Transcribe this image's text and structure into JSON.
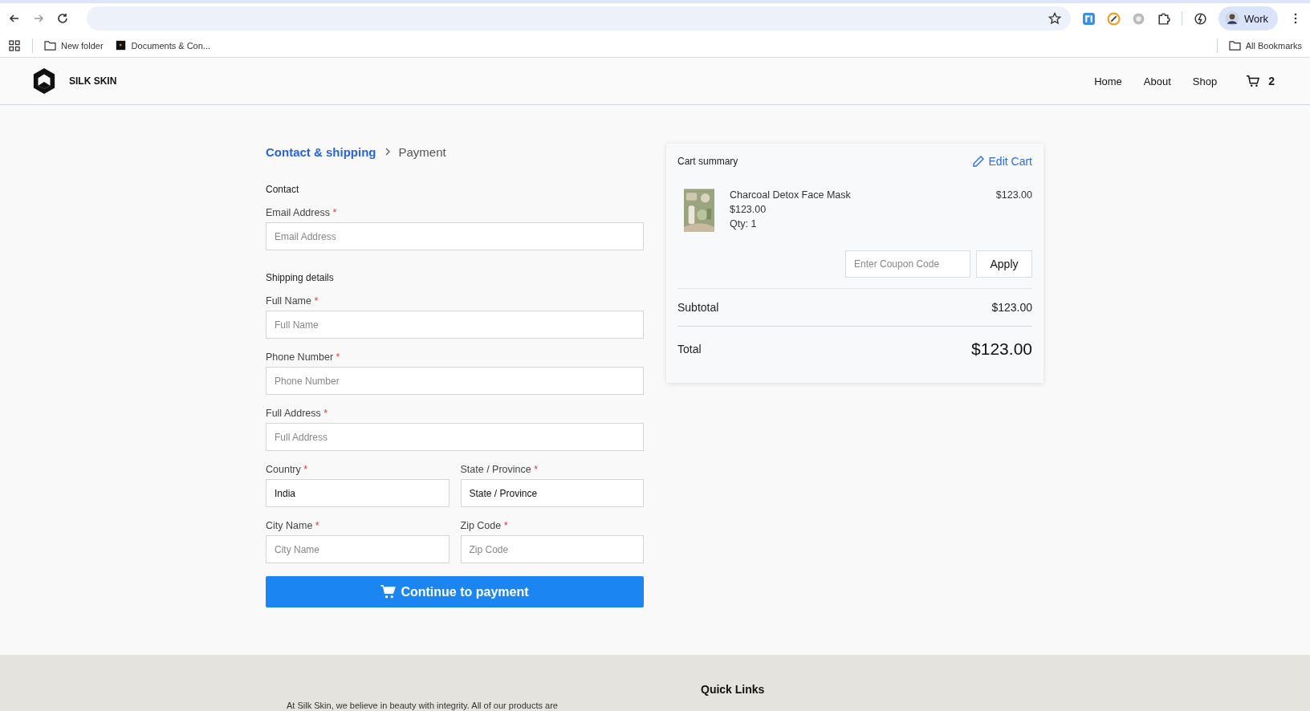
{
  "browser": {
    "bookmarks": [
      {
        "kind": "folder",
        "label": "New folder"
      },
      {
        "kind": "page",
        "label": "Documents & Con..."
      }
    ],
    "all_bookmarks": "All Bookmarks",
    "profile": "Work"
  },
  "header": {
    "brand": "SILK SKIN",
    "nav": [
      "Home",
      "About",
      "Shop"
    ],
    "cart_count": "2"
  },
  "breadcrumb": [
    {
      "label": "Contact & shipping",
      "selected": true
    },
    {
      "label": "Payment",
      "selected": false
    }
  ],
  "sections": [
    {
      "title": "Contact",
      "rows": [
        [
          {
            "label": "Email Address",
            "required_mark": "*",
            "placeholder": "Email Address"
          }
        ]
      ]
    },
    {
      "title": "Shipping details",
      "rows": [
        [
          {
            "label": "Full Name",
            "required_mark": "*",
            "placeholder": "Full Name"
          }
        ],
        [
          {
            "label": "Phone Number",
            "required_mark": "*",
            "placeholder": "Phone Number"
          }
        ],
        [
          {
            "label": "Full Address",
            "required_mark": "*",
            "placeholder": "Full Address"
          }
        ],
        [
          {
            "label": "Country",
            "required_mark": "*",
            "value": "India"
          },
          {
            "label": "State / Province",
            "required_mark": "*",
            "value": "State / Province"
          }
        ],
        [
          {
            "label": "City Name",
            "required_mark": "*",
            "placeholder": "City Name"
          },
          {
            "label": "Zip Code",
            "required_mark": "*",
            "placeholder": "Zip Code"
          }
        ]
      ]
    }
  ],
  "submit": "Continue to payment",
  "cart": {
    "title": "Cart summary",
    "edit": "Edit Cart",
    "items": [
      {
        "name": "Charcoal Detox Face Mask",
        "price": "$123.00",
        "qty": "Qty: 1",
        "line_total": "$123.00"
      }
    ],
    "coupon_placeholder": "Enter Coupon Code",
    "apply": "Apply",
    "subtotal_label": "Subtotal",
    "subtotal": "$123.00",
    "total_label": "Total",
    "total": "$123.00"
  },
  "footer": {
    "about": "At Silk Skin, we believe in beauty with integrity. All of our products are",
    "quick_links": "Quick Links"
  }
}
